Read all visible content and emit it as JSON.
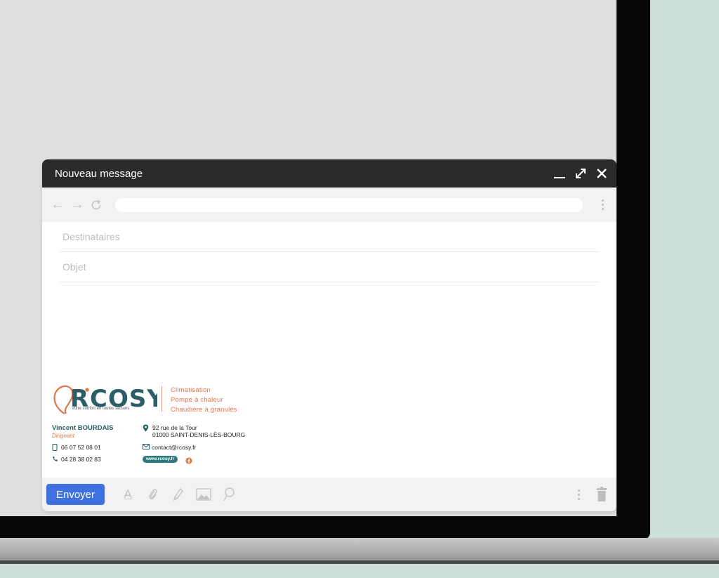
{
  "compose": {
    "title": "Nouveau message",
    "recipients_placeholder": "Destinataires",
    "subject_placeholder": "Objet",
    "send_label": "Envoyer"
  },
  "signature": {
    "logo_text": "R'COSY",
    "tagline": "Votre confort en toutes saisons",
    "services": [
      "Climatisation",
      "Pompe à chaleur",
      "Chaudière à granulés"
    ],
    "name": "Vincent BOURDAIS",
    "role": "Dirigeant",
    "mobile": "06 07 52 08 01",
    "phone": "04 28 38 02 83",
    "address_line1": "92 rue de la Tour",
    "address_line2": "01000 SAINT-DENIS-LÈS-BOURG",
    "email": "contact@rcosy.fr",
    "website": "www.rcosy.fr"
  },
  "colors": {
    "header_bg": "#2a2a2a",
    "send_button": "#3f70e0",
    "brand_teal": "#2b5e67",
    "brand_orange": "#e1764b",
    "background": "#cfe0dc"
  },
  "icons": {
    "header": [
      "minimize-icon",
      "expand-icon",
      "close-icon"
    ],
    "nav": [
      "back-arrow-icon",
      "forward-arrow-icon",
      "refresh-icon",
      "more-vertical-icon"
    ],
    "toolbar": [
      "format-text-icon",
      "attach-icon",
      "pen-icon",
      "image-icon",
      "link-icon",
      "more-vertical-icon",
      "trash-icon"
    ]
  }
}
